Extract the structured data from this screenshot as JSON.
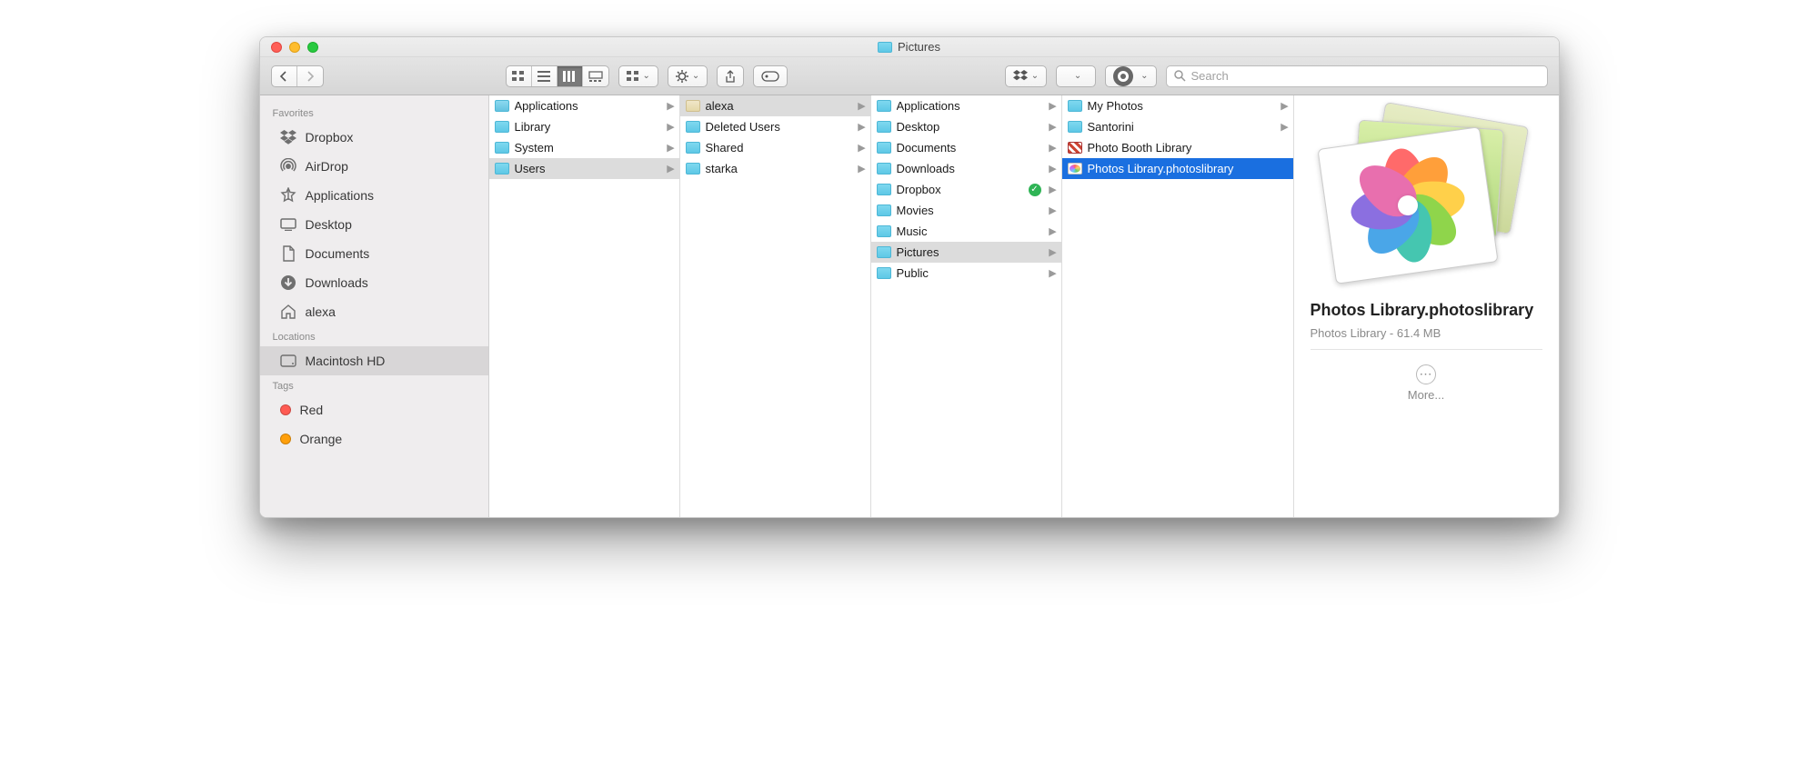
{
  "window": {
    "title": "Pictures"
  },
  "toolbar": {
    "view_modes": [
      "icon",
      "list",
      "column",
      "gallery"
    ],
    "active_view_index": 2,
    "search_placeholder": "Search"
  },
  "sidebar": {
    "sections": [
      {
        "label": "Favorites",
        "items": [
          {
            "icon": "dropbox-icon",
            "label": "Dropbox",
            "selected": false
          },
          {
            "icon": "airdrop-icon",
            "label": "AirDrop",
            "selected": false
          },
          {
            "icon": "applications-icon",
            "label": "Applications",
            "selected": false
          },
          {
            "icon": "desktop-icon",
            "label": "Desktop",
            "selected": false
          },
          {
            "icon": "documents-icon",
            "label": "Documents",
            "selected": false
          },
          {
            "icon": "downloads-icon",
            "label": "Downloads",
            "selected": false
          },
          {
            "icon": "home-icon",
            "label": "alexa",
            "selected": false
          }
        ]
      },
      {
        "label": "Locations",
        "items": [
          {
            "icon": "hdd-icon",
            "label": "Macintosh HD",
            "selected": true
          }
        ]
      },
      {
        "label": "Tags",
        "items": [
          {
            "icon": "tag-dot",
            "color": "#ff5a52",
            "label": "Red",
            "selected": false
          },
          {
            "icon": "tag-dot",
            "color": "#ff9f0a",
            "label": "Orange",
            "selected": false
          }
        ]
      }
    ]
  },
  "columns": [
    {
      "items": [
        {
          "type": "folder",
          "label": "Applications",
          "has_children": true
        },
        {
          "type": "folder",
          "label": "Library",
          "has_children": true
        },
        {
          "type": "folder",
          "label": "System",
          "has_children": true
        },
        {
          "type": "folder",
          "label": "Users",
          "has_children": true,
          "path_selected": true
        }
      ]
    },
    {
      "items": [
        {
          "type": "home-folder",
          "label": "alexa",
          "has_children": true,
          "path_selected": true
        },
        {
          "type": "folder",
          "label": "Deleted Users",
          "has_children": true
        },
        {
          "type": "folder",
          "label": "Shared",
          "has_children": true
        },
        {
          "type": "folder",
          "label": "starka",
          "has_children": true
        }
      ]
    },
    {
      "items": [
        {
          "type": "folder",
          "label": "Applications",
          "has_children": true
        },
        {
          "type": "folder",
          "label": "Desktop",
          "has_children": true
        },
        {
          "type": "folder",
          "label": "Documents",
          "has_children": true
        },
        {
          "type": "folder",
          "label": "Downloads",
          "has_children": true
        },
        {
          "type": "folder",
          "label": "Dropbox",
          "has_children": true,
          "sync_badge": true
        },
        {
          "type": "folder",
          "label": "Movies",
          "has_children": true
        },
        {
          "type": "folder",
          "label": "Music",
          "has_children": true
        },
        {
          "type": "folder",
          "label": "Pictures",
          "has_children": true,
          "path_selected": true
        },
        {
          "type": "folder",
          "label": "Public",
          "has_children": true
        }
      ]
    },
    {
      "items": [
        {
          "type": "folder",
          "label": "My Photos",
          "has_children": true
        },
        {
          "type": "folder",
          "label": "Santorini",
          "has_children": true
        },
        {
          "type": "photobooth",
          "label": "Photo Booth Library",
          "has_children": false
        },
        {
          "type": "photoslib",
          "label": "Photos Library.photoslibrary",
          "has_children": false,
          "selected": true
        }
      ]
    }
  ],
  "preview": {
    "title": "Photos Library.photoslibrary",
    "subtitle": "Photos Library - 61.4 MB",
    "more_label": "More..."
  },
  "colors": {
    "selection": "#1a6fe0",
    "path_selection": "#dcdcdc",
    "sidebar_bg": "#efedee"
  }
}
